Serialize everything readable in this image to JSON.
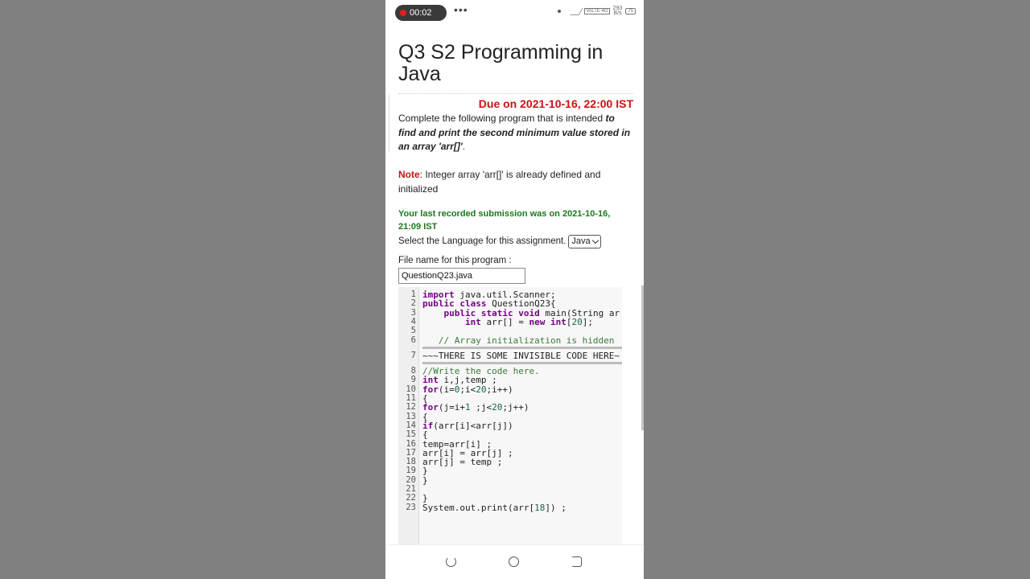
{
  "status_bar": {
    "recording_time": "00:02",
    "network": "4G",
    "volte": "VoLTE",
    "speed_value": "293",
    "speed_unit": "B/s",
    "battery": "75"
  },
  "assignment": {
    "title": "Q3 S2 Programming in Java",
    "due": "Due on 2021-10-16, 22:00 IST",
    "desc_intro": "Complete the following program that is intended ",
    "desc_emphasis": "to find and print the second minimum value stored in an array 'arr[]'",
    "desc_end": ".",
    "note_label": "Note",
    "note_text": ": Integer array 'arr[]' is already defined and initialized",
    "last_submission": "Your last recorded submission was on 2021-10-16, 21:09 IST",
    "language_label": "Select the Language for this assignment.",
    "language_value": "Java",
    "file_label": "File name for this program :",
    "file_name": "QuestionQ23.java"
  },
  "code": {
    "lines": [
      {
        "n": "1",
        "text": "import java.util.Scanner;"
      },
      {
        "n": "2",
        "text": "public class QuestionQ23{"
      },
      {
        "n": "3",
        "text": "    public static void main(String ar"
      },
      {
        "n": "4",
        "text": "        int arr[] = new int[20];"
      },
      {
        "n": "5",
        "text": ""
      },
      {
        "n": "6",
        "text": "   // Array initialization is hidden"
      },
      {
        "n": "7",
        "text": "~~~THERE IS SOME INVISIBLE CODE HERE~"
      },
      {
        "n": "8",
        "text": "//Write the code here."
      },
      {
        "n": "9",
        "text": "int i,j,temp ;"
      },
      {
        "n": "10",
        "text": "for(i=0;i<20;i++)"
      },
      {
        "n": "11",
        "text": "{"
      },
      {
        "n": "12",
        "text": "for(j=i+1 ;j<20;j++)"
      },
      {
        "n": "13",
        "text": "{"
      },
      {
        "n": "14",
        "text": "if(arr[i]<arr[j])"
      },
      {
        "n": "15",
        "text": "{"
      },
      {
        "n": "16",
        "text": "temp=arr[i] ;"
      },
      {
        "n": "17",
        "text": "arr[i] = arr[j] ;"
      },
      {
        "n": "18",
        "text": "arr[j] = temp ;"
      },
      {
        "n": "19",
        "text": "}"
      },
      {
        "n": "20",
        "text": "}"
      },
      {
        "n": "21",
        "text": ""
      },
      {
        "n": "22",
        "text": "}"
      },
      {
        "n": "23",
        "text": "System.out.print(arr[18]) ;"
      }
    ]
  },
  "colors": {
    "due": "#cc1111",
    "submission": "#1a7a1a",
    "keyword": "#770088",
    "number": "#116644",
    "comment": "#3a7a3a"
  },
  "nav": {
    "back_icon": "back-icon",
    "home_icon": "home-icon",
    "recent_icon": "recent-apps-icon"
  }
}
